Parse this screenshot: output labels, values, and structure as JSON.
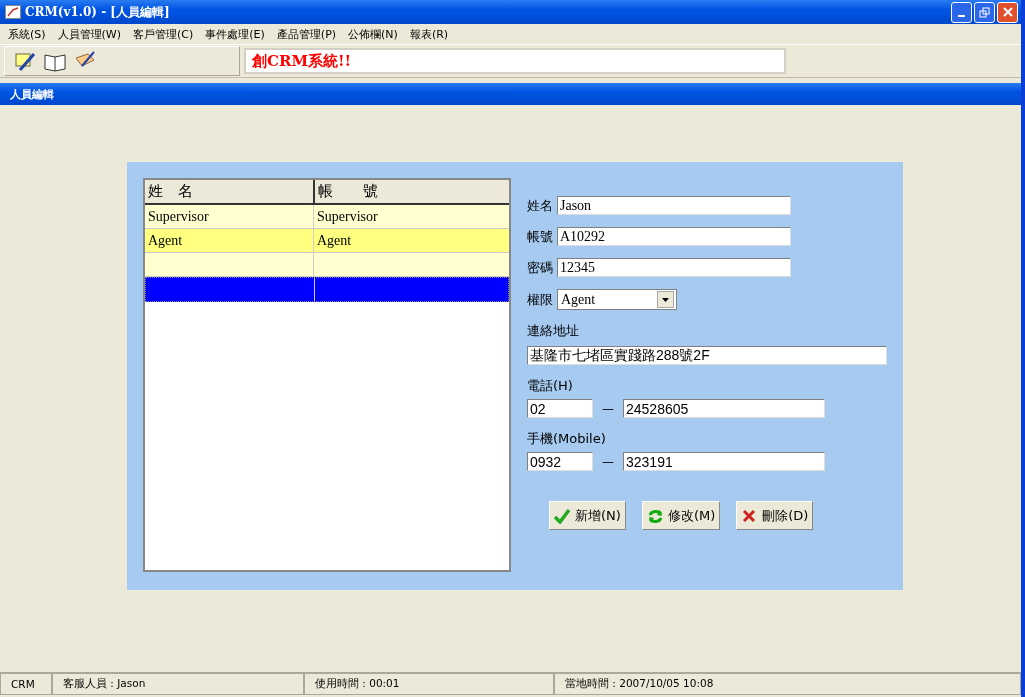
{
  "window": {
    "title": "CRM(v1.0) - [人員編輯]"
  },
  "menu": [
    "系統(S)",
    "人員管理(W)",
    "客戶管理(C)",
    "事件處理(E)",
    "產品管理(P)",
    "公佈欄(N)",
    "報表(R)"
  ],
  "toolbar": {
    "tools": [
      {
        "kind": "edit"
      },
      {
        "kind": "book"
      },
      {
        "kind": "notes"
      }
    ],
    "marquee": "創CRM系統!!"
  },
  "child_window": {
    "title": "人員編輯"
  },
  "table": {
    "columns": [
      "姓　名",
      "帳　　號"
    ],
    "rows": [
      {
        "cells": [
          "Supervisor",
          "Supervisor"
        ],
        "highlighted": false,
        "selected": false
      },
      {
        "cells": [
          "Agent",
          "Agent"
        ],
        "highlighted": true,
        "selected": false
      },
      {
        "highlighted": false,
        "selected": false
      },
      {
        "highlighted": false,
        "selected": true
      }
    ]
  },
  "form": {
    "name": {
      "label": "姓名",
      "value": "Jason"
    },
    "account": {
      "label": "帳號",
      "value": "A10292"
    },
    "password": {
      "label": "密碼",
      "value": "12345"
    },
    "role": {
      "label": "權限",
      "value": "Agent"
    },
    "address": {
      "label": "連絡地址",
      "value": "基隆市七堵區實踐路288號2F"
    },
    "phone": {
      "label": "電話(H)",
      "area": "02",
      "number": "24528605",
      "separator": "—"
    },
    "mobile": {
      "label": "手機(Mobile)",
      "area": "0932",
      "number": "323191",
      "separator": "—"
    }
  },
  "buttons": [
    {
      "kind": "add",
      "label": "新增(N)"
    },
    {
      "kind": "modify",
      "label": "修改(M)"
    },
    {
      "kind": "delete",
      "label": "刪除(D)"
    }
  ],
  "status_bar": [
    "CRM",
    "客服人員 : Jason",
    "使用時間 : 00:01",
    "當地時間 : 2007/10/05 10:08"
  ]
}
